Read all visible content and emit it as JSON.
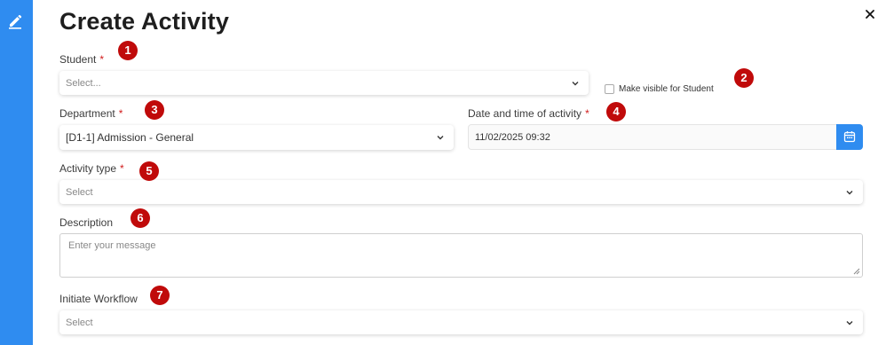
{
  "dialog": {
    "title": "Create Activity",
    "close_icon": "close-icon",
    "sidebar_icon": "edit-icon"
  },
  "form": {
    "student": {
      "label": "Student",
      "required_mark": "*",
      "placeholder": "Select..."
    },
    "visible_for_student": {
      "label": "Make visible for Student",
      "checked": false
    },
    "department": {
      "label": "Department",
      "required_mark": "*",
      "value": "[D1-1] Admission - General"
    },
    "datetime": {
      "label": "Date and time of activity",
      "required_mark": "*",
      "value": "11/02/2025 09:32",
      "icon": "calendar-icon"
    },
    "activity_type": {
      "label": "Activity type",
      "required_mark": "*",
      "placeholder": "Select"
    },
    "description": {
      "label": "Description",
      "placeholder": "Enter your message"
    },
    "initiate_workflow": {
      "label": "Initiate Workflow",
      "placeholder": "Select"
    }
  },
  "annotations": [
    "1",
    "2",
    "3",
    "4",
    "5",
    "6",
    "7"
  ],
  "colors": {
    "accent": "#2f8cf0",
    "required": "#d11c1c",
    "badge": "#c00a0a"
  }
}
